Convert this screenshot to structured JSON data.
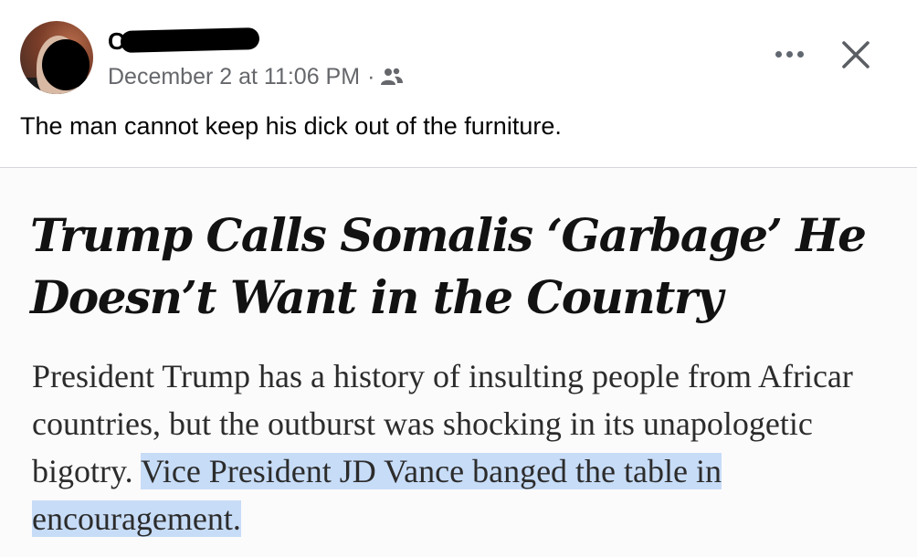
{
  "post": {
    "author_visible_initial": "C",
    "timestamp": "December 2 at 11:06 PM",
    "separator": "·",
    "audience_icon": "friends-icon",
    "text": "The man cannot keep his dick out of the furniture."
  },
  "controls": {
    "more_icon": "more-horizontal-icon",
    "close_icon": "close-icon"
  },
  "article": {
    "headline_lines": [
      "Trump Calls Somalis ‘Garbage’ He",
      "Doesn’t Want in the Country"
    ],
    "summary_lines": [
      "President Trump has a history of insulting people from Africar",
      "countries, but the outburst was shocking in its unapologetic",
      "bigotry. "
    ],
    "summary_highlighted": [
      "Vice President JD Vance banged the table in",
      "encouragement."
    ]
  },
  "colors": {
    "meta_text": "#65676b",
    "highlight": "#c7dcf7",
    "headline_text": "#121212"
  }
}
